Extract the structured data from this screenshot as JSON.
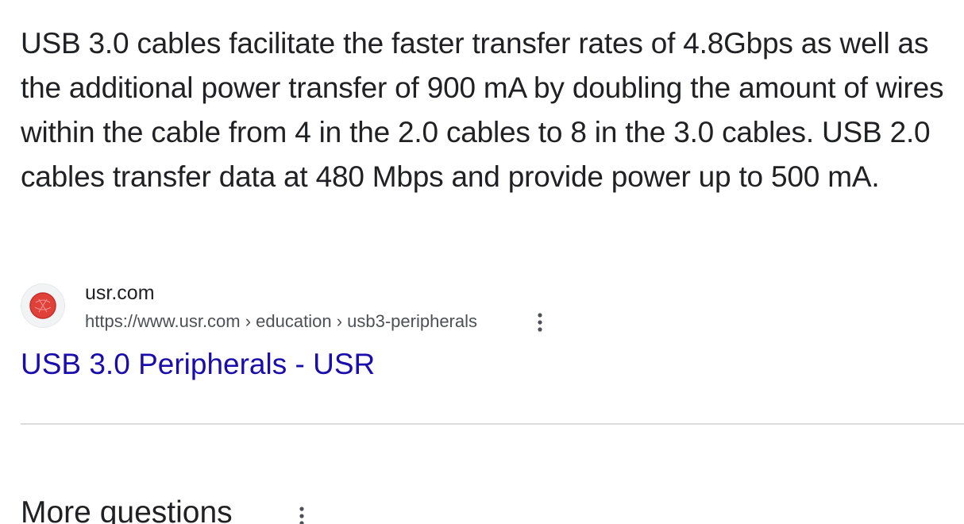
{
  "answer": {
    "snippet": "USB 3.0 cables facilitate the faster transfer rates of 4.8Gbps as well as the additional power transfer of 900 mA by doubling the amount of wires within the cable from 4 in the 2.0 cables to 8 in the 3.0 cables. USB 2.0 cables transfer data at 480 Mbps and provide power up to 500 mA."
  },
  "source": {
    "favicon_icon": "usr-logo-icon",
    "favicon_color": "#e0403a",
    "site_name": "usr.com",
    "url": "https://www.usr.com › education › usb3-peripherals",
    "more_icon": "vertical-ellipsis-icon"
  },
  "result": {
    "title": "USB 3.0 Peripherals - USR",
    "link_color": "#1a0dab"
  },
  "more_questions": {
    "heading": "More questions",
    "more_icon": "vertical-ellipsis-icon"
  }
}
